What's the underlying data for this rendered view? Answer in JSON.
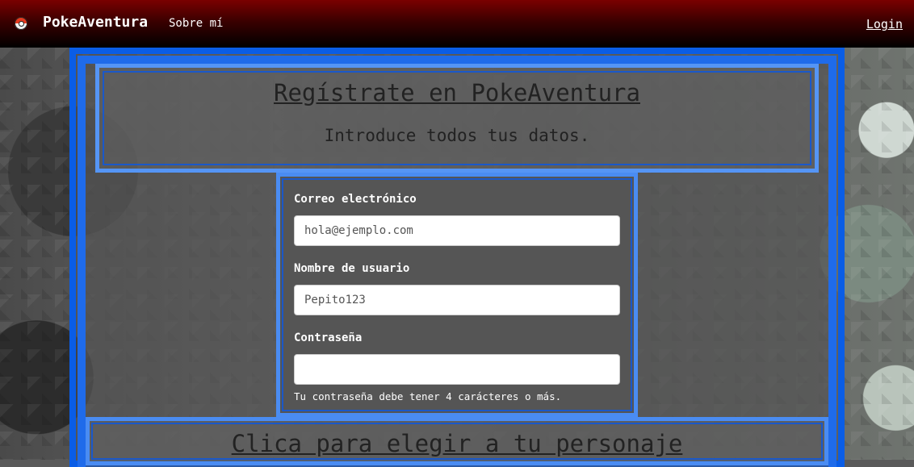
{
  "navbar": {
    "brand": "PokeAventura",
    "brand_icon": "pokeball-icon",
    "links": [
      {
        "label": "Sobre mí"
      }
    ],
    "login_label": "Login"
  },
  "header": {
    "title": "Regístrate en PokeAventura",
    "subtitle": "Introduce todos tus datos."
  },
  "form": {
    "email": {
      "label": "Correo electrónico",
      "placeholder": "hola@ejemplo.com",
      "value": ""
    },
    "username": {
      "label": "Nombre de usuario",
      "placeholder": "Pepito123",
      "value": ""
    },
    "password": {
      "label": "Contraseña",
      "placeholder": "",
      "value": "",
      "help": "Tu contraseña debe tener 4 carácteres o más."
    }
  },
  "character_prompt": "Clica para elegir a tu personaje",
  "colors": {
    "frame_blue": "#0a5de6",
    "frame_light_blue": "#5595f5",
    "navbar_red": "#7a0000"
  }
}
